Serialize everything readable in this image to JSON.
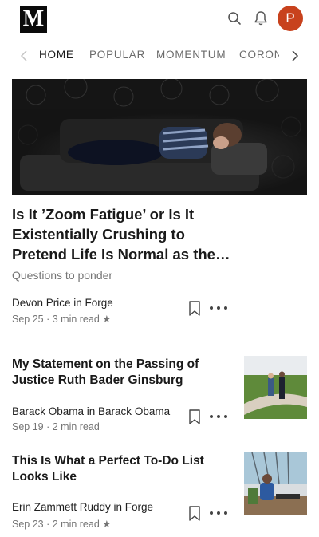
{
  "header": {
    "logo_letter": "M",
    "avatar_letter": "P",
    "accent": "#c8421d",
    "icons": [
      "search-icon",
      "bell-icon"
    ]
  },
  "tabs": {
    "items": [
      {
        "label": "HOME",
        "active": true
      },
      {
        "label": "POPULAR",
        "active": false
      },
      {
        "label": "MOMENTUM",
        "active": false
      },
      {
        "label": "CORONAVIRUS",
        "active": false
      }
    ]
  },
  "featured": {
    "title": "Is It ’Zoom Fatigue’ or Is It Existentially Crushing to Pretend Life Is Normal as the…",
    "subtitle": "Questions to ponder",
    "author": "Devon Price in Forge",
    "meta": "Sep 25 · 3 min read ★"
  },
  "posts": [
    {
      "title": "My Statement on the Passing of Justice Ruth Bader Ginsburg",
      "author": "Barack Obama in Barack Obama",
      "meta": "Sep 19 · 2 min read"
    },
    {
      "title": "This Is What a Perfect To-Do List Looks Like",
      "author": "Erin Zammett Ruddy in Forge",
      "meta": "Sep 23 · 2 min read ★"
    }
  ]
}
